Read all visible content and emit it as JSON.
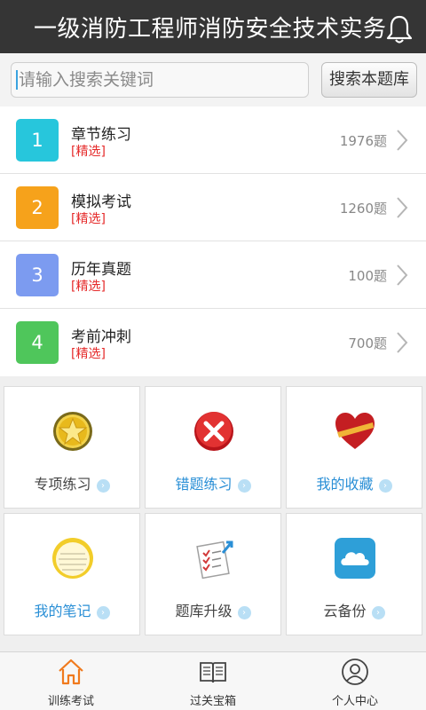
{
  "header": {
    "title": "一级消防工程师消防安全技术实务",
    "bell_icon": "bell-icon"
  },
  "search": {
    "placeholder": "请输入搜索关键词",
    "button_label": "搜索本题库"
  },
  "list": [
    {
      "number": "1",
      "title": "章节练习",
      "tag": "[精选]",
      "count": "1976题",
      "color": "#27c6dc"
    },
    {
      "number": "2",
      "title": "模拟考试",
      "tag": "[精选]",
      "count": "1260题",
      "color": "#f6a21b"
    },
    {
      "number": "3",
      "title": "历年真题",
      "tag": "[精选]",
      "count": "100题",
      "color": "#7c9bf0"
    },
    {
      "number": "4",
      "title": "考前冲刺",
      "tag": "[精选]",
      "count": "700题",
      "color": "#4fc65b"
    }
  ],
  "grid": [
    {
      "label": "专项练习",
      "icon": "star-medal-icon"
    },
    {
      "label": "错题练习",
      "icon": "red-x-icon"
    },
    {
      "label": "我的收藏",
      "icon": "heart-icon"
    },
    {
      "label": "我的笔记",
      "icon": "notepad-icon"
    },
    {
      "label": "题库升级",
      "icon": "checklist-upgrade-icon"
    },
    {
      "label": "云备份",
      "icon": "cloud-icon"
    }
  ],
  "tabs": [
    {
      "label": "训练考试",
      "icon": "home-icon"
    },
    {
      "label": "过关宝箱",
      "icon": "book-icon"
    },
    {
      "label": "个人中心",
      "icon": "person-icon"
    }
  ],
  "colors": {
    "header_bg": "#353535",
    "accent_blue": "#2a8fd6",
    "tag_red": "#e52a2a",
    "active_tab": "#f07a1d"
  }
}
